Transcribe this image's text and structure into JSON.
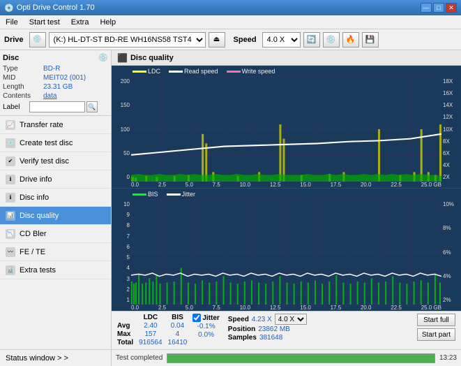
{
  "app": {
    "title": "Opti Drive Control 1.70",
    "title_icon": "💿"
  },
  "titlebar": {
    "minimize": "—",
    "maximize": "□",
    "close": "✕"
  },
  "menubar": {
    "items": [
      "File",
      "Start test",
      "Extra",
      "Help"
    ]
  },
  "drivetoolbar": {
    "drive_label": "Drive",
    "drive_value": "(K:)  HL-DT-ST BD-RE  WH16NS58 TST4",
    "speed_label": "Speed",
    "speed_value": "4.0 X"
  },
  "disc": {
    "title": "Disc",
    "type_label": "Type",
    "type_value": "BD-R",
    "mid_label": "MID",
    "mid_value": "MEIT02 (001)",
    "length_label": "Length",
    "length_value": "23.31 GB",
    "contents_label": "Contents",
    "contents_value": "data",
    "label_label": "Label",
    "label_input": ""
  },
  "nav": {
    "items": [
      {
        "id": "transfer-rate",
        "label": "Transfer rate",
        "active": false
      },
      {
        "id": "create-test-disc",
        "label": "Create test disc",
        "active": false
      },
      {
        "id": "verify-test-disc",
        "label": "Verify test disc",
        "active": false
      },
      {
        "id": "drive-info",
        "label": "Drive info",
        "active": false
      },
      {
        "id": "disc-info",
        "label": "Disc info",
        "active": false
      },
      {
        "id": "disc-quality",
        "label": "Disc quality",
        "active": true
      },
      {
        "id": "cd-bler",
        "label": "CD Bler",
        "active": false
      },
      {
        "id": "fe-te",
        "label": "FE / TE",
        "active": false
      },
      {
        "id": "extra-tests",
        "label": "Extra tests",
        "active": false
      }
    ],
    "status_window": "Status window > >"
  },
  "content": {
    "title": "Disc quality",
    "chart_top": {
      "legend": [
        {
          "label": "LDC",
          "color": "#ffff00"
        },
        {
          "label": "Read speed",
          "color": "#ffffff"
        },
        {
          "label": "Write speed",
          "color": "#ff69b4"
        }
      ],
      "y_axis_left": [
        "200",
        "150",
        "100",
        "50",
        "0"
      ],
      "y_axis_right": [
        "18X",
        "16X",
        "14X",
        "12X",
        "10X",
        "8X",
        "6X",
        "4X",
        "2X"
      ],
      "x_axis": [
        "0.0",
        "2.5",
        "5.0",
        "7.5",
        "10.0",
        "12.5",
        "15.0",
        "17.5",
        "20.0",
        "22.5",
        "25.0 GB"
      ]
    },
    "chart_bottom": {
      "legend": [
        {
          "label": "BIS",
          "color": "#00ff00"
        },
        {
          "label": "Jitter",
          "color": "#ffffff"
        }
      ],
      "y_axis_left": [
        "10",
        "9",
        "8",
        "7",
        "6",
        "5",
        "4",
        "3",
        "2",
        "1"
      ],
      "y_axis_right": [
        "10%",
        "8%",
        "6%",
        "4%",
        "2%"
      ],
      "x_axis": [
        "0.0",
        "2.5",
        "5.0",
        "7.5",
        "10.0",
        "12.5",
        "15.0",
        "17.5",
        "20.0",
        "22.5",
        "25.0 GB"
      ]
    }
  },
  "stats": {
    "col_ldc": "LDC",
    "col_bis": "BIS",
    "jitter_label": "Jitter",
    "jitter_checked": true,
    "speed_label": "Speed",
    "speed_value": "4.23 X",
    "speed_select": "4.0 X",
    "position_label": "Position",
    "position_value": "23862 MB",
    "samples_label": "Samples",
    "samples_value": "381648",
    "rows": [
      {
        "label": "Avg",
        "ldc": "2.40",
        "bis": "0.04",
        "jitter": "-0.1%"
      },
      {
        "label": "Max",
        "ldc": "157",
        "bis": "4",
        "jitter": "0.0%"
      },
      {
        "label": "Total",
        "ldc": "916564",
        "bis": "16410",
        "jitter": ""
      }
    ],
    "start_full": "Start full",
    "start_part": "Start part"
  },
  "statusbar": {
    "status": "Test completed",
    "progress": 100,
    "time": "13:23"
  }
}
